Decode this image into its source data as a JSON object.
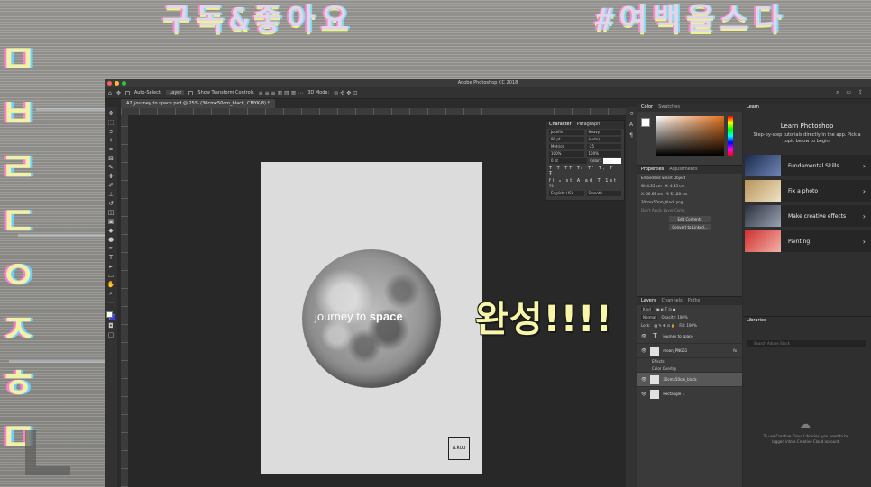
{
  "backdrop": {
    "title_left": "구독&좋아요",
    "title_right": "#여백을스다",
    "left_glyphs": [
      "ㅁ",
      "ㅂ",
      "ㄹ",
      "ㄷ",
      "ㅇ",
      "ㅈ",
      "ㅎ",
      "ㅁ"
    ]
  },
  "window": {
    "title": "Adobe Photoshop CC 2018",
    "document_tab": "A2_journey to space.psd @ 25% (30cmx50cm_black, CMYK/8) *"
  },
  "options_bar": {
    "auto_select_label": "Auto-Select:",
    "auto_select_value": "Layer",
    "show_transform_label": "Show Transform Controls",
    "mode_3d": "3D Mode:"
  },
  "poster": {
    "text_light": "journey to ",
    "text_bold": "space",
    "logo": "a.koo"
  },
  "overlay": {
    "done_text": "완성!!!!"
  },
  "character_panel": {
    "tabs": [
      "Character",
      "Paragraph"
    ],
    "font_family": "Josefin",
    "font_style": "Heavy",
    "size": "90 pt",
    "leading": "(Auto)",
    "kerning": "Metrics",
    "tracking": "-25",
    "vertical_scale": "100%",
    "horizontal_scale": "100%",
    "baseline": "0 pt",
    "color_label": "Color:",
    "language": "English: USA",
    "antialias": "Smooth"
  },
  "color_panel": {
    "tabs": [
      "Color",
      "Swatches"
    ],
    "accent": "#e0711d"
  },
  "properties_panel": {
    "tabs": [
      "Properties",
      "Adjustments"
    ],
    "type_label": "Embedded Smart Object",
    "w": "W: 4.35 cm",
    "h": "H: 4.35 cm",
    "x": "X: 36.65 cm",
    "y": "Y: 51.88 cm",
    "file": "30cmx50cm_black.png",
    "comps_placeholder": "Don't Apply Layer Comp",
    "edit_contents": "Edit Contents",
    "convert_linked": "Convert to Linked..."
  },
  "layers_panel": {
    "tabs": [
      "Layers",
      "Channels",
      "Paths"
    ],
    "kind": "Kind",
    "blend": "Normal",
    "opacity": "Opacity: 100%",
    "lock": "Lock:",
    "fill": "Fill: 100%",
    "layers": [
      {
        "name": "journey to space",
        "type": "text"
      },
      {
        "name": "moon_PNG51",
        "type": "image",
        "fx": "fx"
      },
      {
        "name": "Effects",
        "type": "sub"
      },
      {
        "name": "Color Overlay",
        "type": "sub"
      },
      {
        "name": "30cmx50cm_black",
        "type": "image",
        "selected": true
      },
      {
        "name": "Rectangle 1",
        "type": "image"
      }
    ]
  },
  "learn_panel": {
    "tab": "Learn",
    "heading": "Learn Photoshop",
    "description": "Step-by-step tutorials directly in the app. Pick a topic below to begin.",
    "cards": [
      "Fundamental Skills",
      "Fix a photo",
      "Make creative effects",
      "Painting"
    ],
    "libraries_tab": "Libraries",
    "libraries_search": "Search Adobe Stock",
    "libraries_message": "To use Creative Cloud Libraries, you need to be logged into a Creative Cloud account."
  }
}
